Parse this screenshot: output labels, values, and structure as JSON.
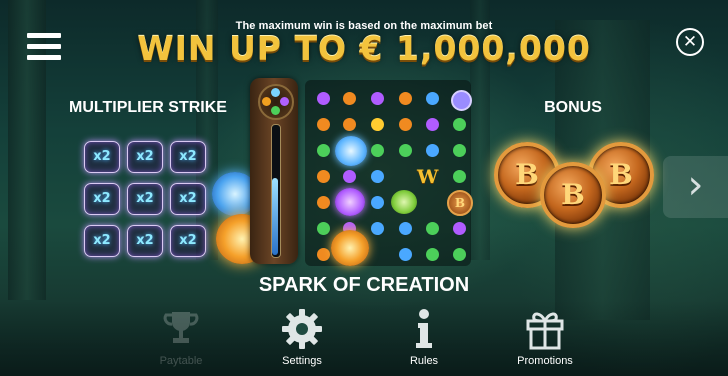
{
  "header": {
    "notice": "The maximum win is based on the maximum bet",
    "headline": "WIN UP TO € 1,000,000"
  },
  "multiplier_strike": {
    "title": "MULTIPLIER STRIKE",
    "cells": [
      "x2",
      "x2",
      "x2",
      "x2",
      "x2",
      "x2",
      "x2",
      "x2",
      "x2"
    ]
  },
  "reels": {
    "wild_symbol": "W",
    "bonus_symbol": "B"
  },
  "bonus": {
    "title": "BONUS",
    "coins": [
      "B",
      "B",
      "B"
    ]
  },
  "feature_title": "SPARK OF CREATION",
  "nav": {
    "paytable": "Paytable",
    "settings": "Settings",
    "rules": "Rules",
    "promotions": "Promotions"
  },
  "icons": {
    "menu": "hamburger-icon",
    "close": "close-circle-icon",
    "next": "chevron-right-icon",
    "paytable": "trophy-icon",
    "settings": "gear-icon",
    "rules": "info-icon",
    "promotions": "gift-icon"
  }
}
